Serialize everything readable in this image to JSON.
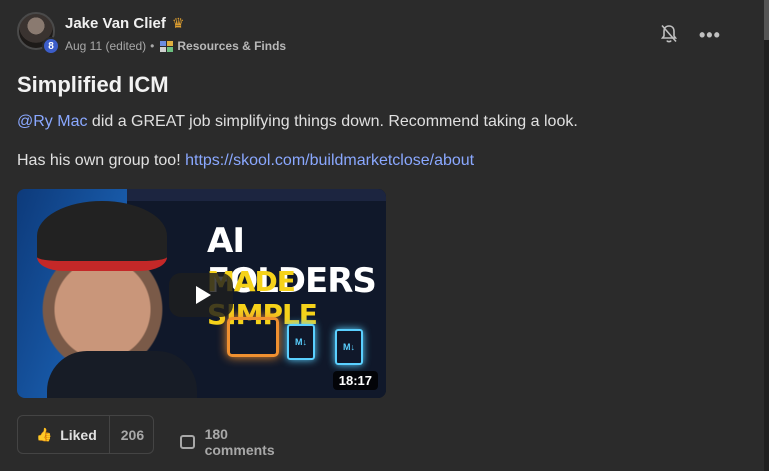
{
  "post": {
    "author": "Jake Van Clief",
    "level": "8",
    "date": "Aug 11 (edited)",
    "separator": "•",
    "category": "Resources & Finds",
    "title": "Simplified ICM",
    "mention": "@Ry Mac",
    "body1_rest": " did a GREAT job simplifying things down. Recommend taking a look.",
    "body2_text": "Has his own group too! ",
    "link": "https://skool.com/buildmarketclose/about",
    "more_label": "•••"
  },
  "video": {
    "title_line1": "AI FOLDERS",
    "title_line2": "MADE SIMPLE",
    "doc_label": "M↓",
    "duration": "18:17"
  },
  "actions": {
    "like_label": "Liked",
    "like_count": "206",
    "comments_label": "180 comments"
  },
  "icons": {
    "crown": "crown-icon",
    "bell": "bell-off-icon",
    "thumb": "thumbs-up-icon",
    "comment": "comment-icon"
  },
  "colors": {
    "background": "#2b2b2b",
    "link": "#8aa8ff",
    "level_badge": "#3c5dc9",
    "crown": "#e0a030"
  }
}
